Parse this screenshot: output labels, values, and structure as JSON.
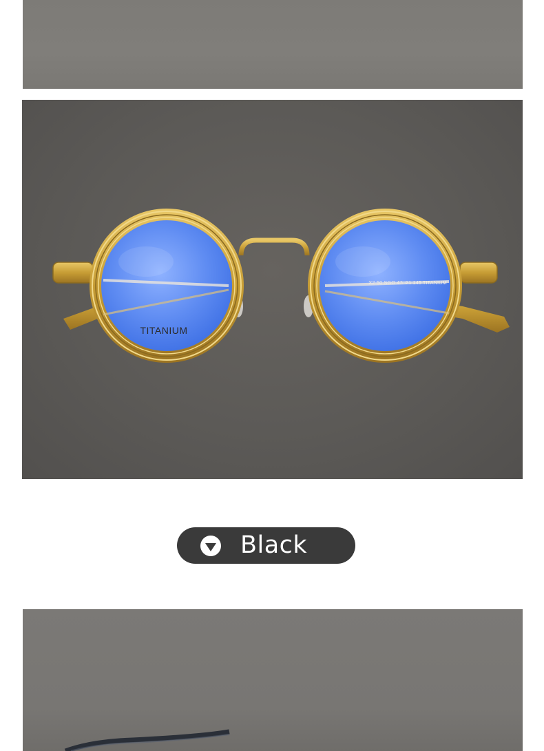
{
  "images": {
    "top": {
      "name": "product-photo-top-crop"
    },
    "main": {
      "name": "gold-round-titanium-eyeglasses",
      "lens_print": "TITANIUM",
      "temple_print": "X2-50 SGO 47□21 145 TITANIUM"
    },
    "bottom": {
      "name": "product-photo-bottom-crop"
    }
  },
  "color_selector": {
    "label": "Black",
    "icon": "triangle-down-icon"
  },
  "colors": {
    "pill_bg": "#3a3a3a",
    "frame_gold": "#c9a23a",
    "lens_blue": "#5f8cf2"
  }
}
